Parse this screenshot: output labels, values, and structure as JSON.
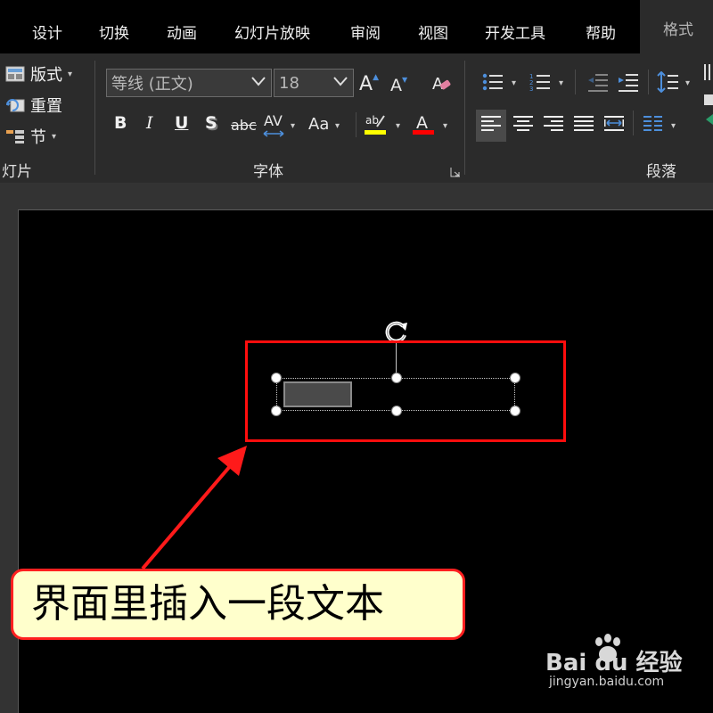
{
  "menu": {
    "tabs": [
      {
        "label": "设计"
      },
      {
        "label": "切换"
      },
      {
        "label": "动画"
      },
      {
        "label": "幻灯片放映"
      },
      {
        "label": "审阅"
      },
      {
        "label": "视图"
      },
      {
        "label": "开发工具"
      },
      {
        "label": "帮助"
      },
      {
        "label": "格式"
      }
    ],
    "active_tab": "格式"
  },
  "ribbon": {
    "slides_group": {
      "label": "灯片",
      "layout_label": "版式",
      "reset_label": "重置",
      "section_label": "节"
    },
    "font_group": {
      "label": "字体",
      "font_name": "等线 (正文)",
      "font_size": "18",
      "increase_size": "A",
      "decrease_size": "A",
      "bold": "B",
      "italic": "I",
      "underline": "U",
      "shadow": "S",
      "strikethrough": "abc",
      "char_spacing": "AV",
      "change_case": "Aa",
      "highlight_color": "#ffff00",
      "font_color": "#ff0000"
    },
    "paragraph_group": {
      "label": "段落"
    }
  },
  "slide": {
    "callout_text": "界面里插入一段文本"
  },
  "watermark": {
    "brand": "Bai du 经验",
    "url": "jingyan.baidu.com"
  },
  "colors": {
    "annotation_red": "#ff0d0d",
    "callout_bg": "#ffffcc"
  }
}
